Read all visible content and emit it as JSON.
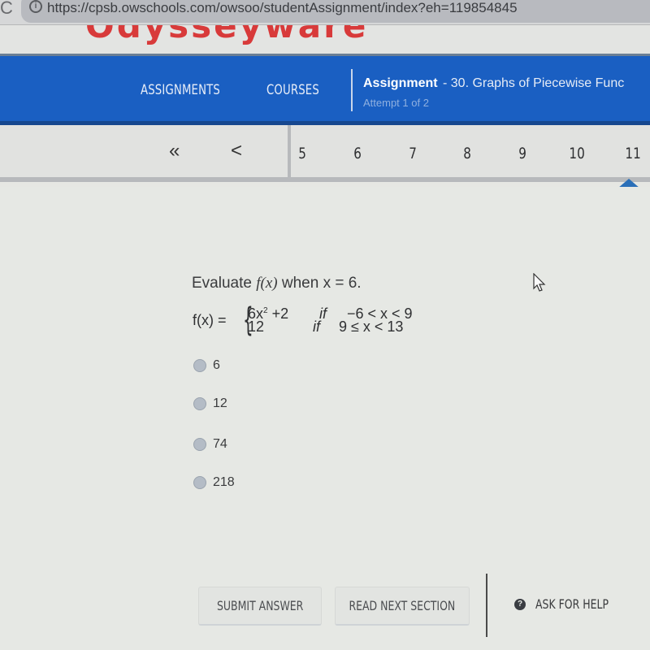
{
  "browser": {
    "url": "https://cpsb.owschools.com/owsoo/studentAssignment/index?eh=119854845",
    "reload_glyph": "C",
    "info_glyph": "i"
  },
  "logo": {
    "text": "Odysseyware"
  },
  "nav": {
    "assignments_label": "ASSIGNMENTS",
    "courses_label": "COURSES",
    "assignment_title": "Assignment",
    "assignment_name": " - 30. Graphs of Piecewise Func",
    "attempt": "Attempt 1 of 2"
  },
  "question_nav": {
    "first_glyph": "«",
    "prev_glyph": "<",
    "numbers": [
      "5",
      "6",
      "7",
      "8",
      "9",
      "10",
      "11"
    ],
    "active": "11"
  },
  "question": {
    "prompt_pre": "Evaluate ",
    "prompt_func": "f(x)",
    "prompt_post": " when x = 6.",
    "func_label": "f(x) =",
    "brace": "{",
    "case1_expr_base": "6x",
    "case1_expr_exp": "2",
    "case1_expr_tail": " +2",
    "case1_if": "if",
    "case1_cond": "−6 < x < 9",
    "case2_expr": "12",
    "case2_if": "if",
    "case2_cond": "9 ≤ x < 13",
    "choices": [
      "6",
      "12",
      "74",
      "218"
    ]
  },
  "actions": {
    "submit_label": "SUBMIT ANSWER",
    "next_section_label": "READ NEXT SECTION",
    "help_label": "ASK FOR HELP",
    "help_glyph": "?"
  },
  "colors": {
    "nav_blue": "#1a5fc2",
    "logo_red": "#d83a3a",
    "active_marker": "#2a6fb8"
  }
}
